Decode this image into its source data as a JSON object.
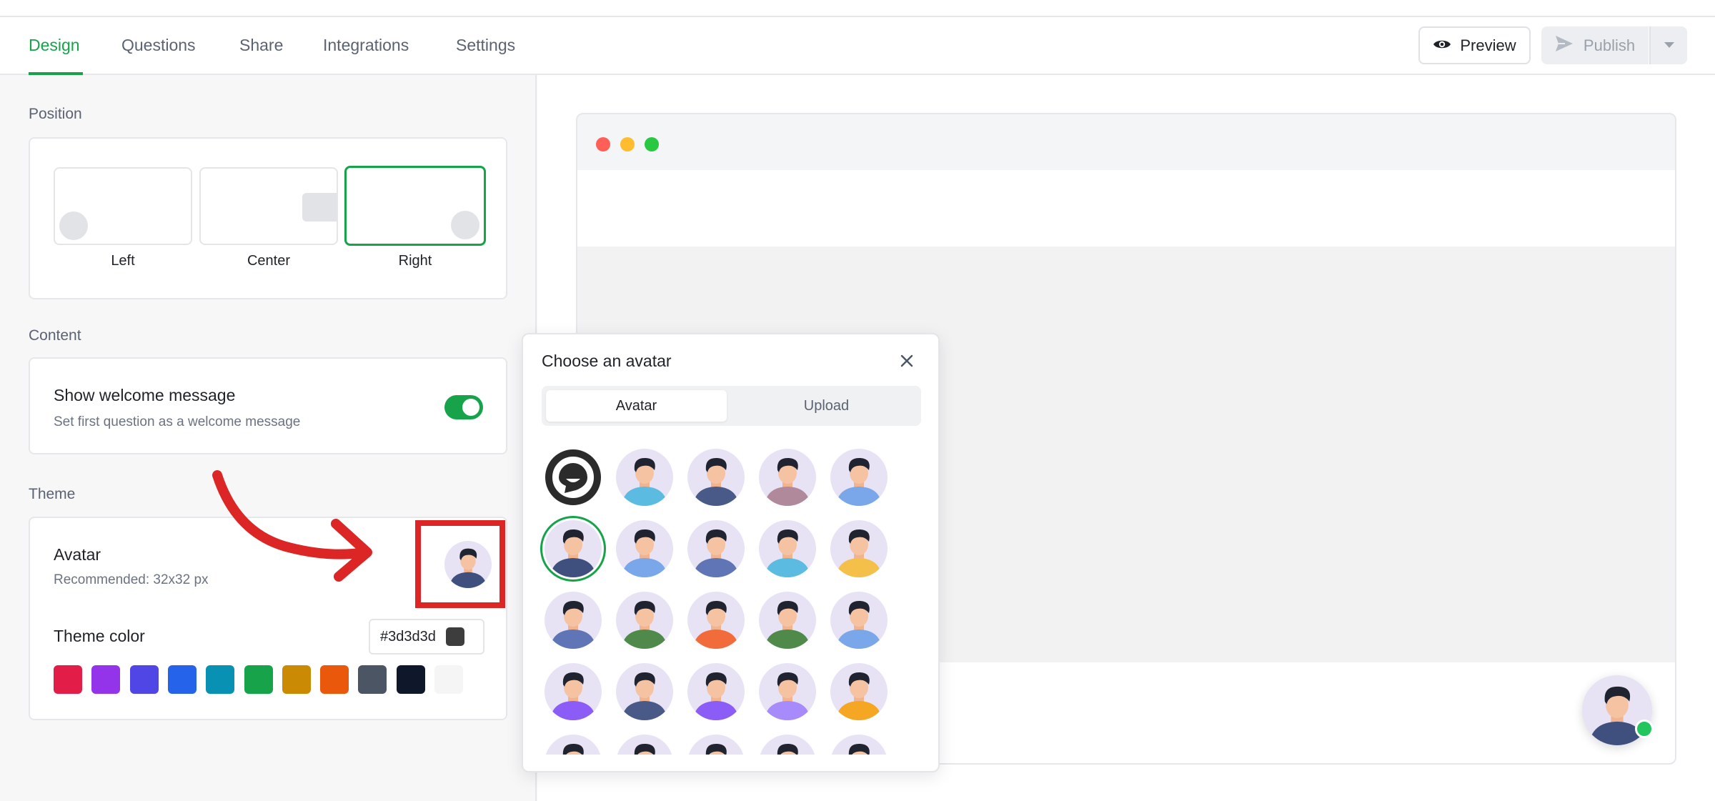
{
  "tabs": [
    {
      "label": "Design",
      "active": true
    },
    {
      "label": "Questions"
    },
    {
      "label": "Share"
    },
    {
      "label": "Integrations"
    },
    {
      "label": "Settings"
    }
  ],
  "header": {
    "preview_label": "Preview",
    "publish_label": "Publish"
  },
  "position": {
    "section_label": "Position",
    "options": [
      {
        "label": "Left"
      },
      {
        "label": "Center"
      },
      {
        "label": "Right",
        "selected": true
      }
    ]
  },
  "content": {
    "section_label": "Content",
    "welcome_title": "Show welcome message",
    "welcome_sub": "Set first question as a welcome message",
    "welcome_enabled": true
  },
  "theme": {
    "section_label": "Theme",
    "avatar_title": "Avatar",
    "avatar_sub": "Recommended: 32x32 px",
    "color_title": "Theme color",
    "color_value": "#3d3d3d",
    "swatches": [
      "#e11d48",
      "#9333ea",
      "#4f46e5",
      "#2563eb",
      "#0891b2",
      "#16a34a",
      "#ca8a04",
      "#ea580c",
      "#4b5563",
      "#0f172a",
      "#f5f5f5"
    ]
  },
  "avatar_picker": {
    "title": "Choose an avatar",
    "tabs": [
      {
        "label": "Avatar",
        "active": true
      },
      {
        "label": "Upload"
      }
    ],
    "avatars": [
      {
        "shirt": "#ffffff",
        "logo": true
      },
      {
        "shirt": "#5cbbe0"
      },
      {
        "shirt": "#4a5a88"
      },
      {
        "shirt": "#b08a9a"
      },
      {
        "shirt": "#7aa6ea"
      },
      {
        "shirt": "#3f4f7e",
        "selected": true
      },
      {
        "shirt": "#7aa6ea"
      },
      {
        "shirt": "#5f75b5"
      },
      {
        "shirt": "#5cbbe0"
      },
      {
        "shirt": "#f5c04a"
      },
      {
        "shirt": "#5f75b5"
      },
      {
        "shirt": "#4f8a4a"
      },
      {
        "shirt": "#f26b3a"
      },
      {
        "shirt": "#4f8a4a"
      },
      {
        "shirt": "#7aa6ea"
      },
      {
        "shirt": "#8b5cf6"
      },
      {
        "shirt": "#4a5a88"
      },
      {
        "shirt": "#8b5cf6"
      },
      {
        "shirt": "#a78bfa"
      },
      {
        "shirt": "#f5a623"
      },
      {
        "shirt": "#f5c04a"
      },
      {
        "shirt": "#ec4899"
      },
      {
        "shirt": "#f5a623"
      },
      {
        "shirt": "#4a5a88"
      },
      {
        "shirt": "#7aa6ea"
      }
    ]
  },
  "colors": {
    "accent": "#16a34a",
    "highlight": "#dc2626"
  },
  "icons": {
    "preview": "eye-icon",
    "publish": "send-icon",
    "caret": "chevron-down-icon",
    "close": "close-icon"
  }
}
